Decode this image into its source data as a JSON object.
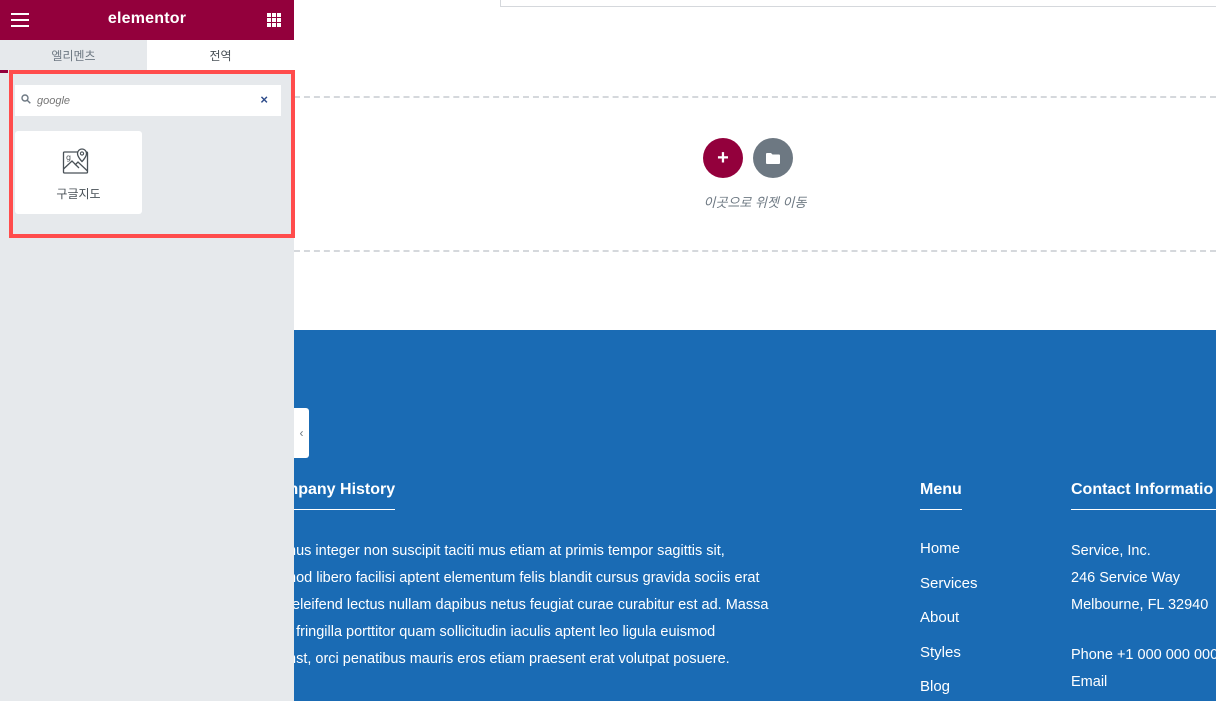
{
  "panel": {
    "logo": "elementor",
    "tabs": [
      {
        "label": "엘리멘츠",
        "active": true
      },
      {
        "label": "전역",
        "active": false
      }
    ],
    "search": {
      "value": "",
      "placeholder": "google"
    },
    "widgets": [
      {
        "label": "구글지도",
        "icon": "map-pin-icon"
      }
    ],
    "accent_color": "#93003c",
    "highlight_color": "#ff4c4c"
  },
  "canvas": {
    "drop_text": "이곳으로 위젯 이동",
    "add_symbol": "+"
  },
  "footer": {
    "background": "#1a6bb4",
    "history": {
      "title": "mpany History",
      "lines": [
        "mus integer non suscipit taciti mus etiam at primis tempor sagittis sit,",
        "mod libero facilisi aptent elementum felis blandit cursus gravida sociis erat",
        ", eleifend lectus nullam dapibus netus feugiat curae curabitur est ad. Massa",
        "e fringilla porttitor quam sollicitudin iaculis aptent leo ligula euismod",
        "mst, orci penatibus mauris eros etiam praesent erat volutpat posuere."
      ]
    },
    "menu": {
      "title": "Menu",
      "items": [
        "Home",
        "Services",
        "About",
        "Styles",
        "Blog"
      ]
    },
    "contact": {
      "title": "Contact Informatio",
      "lines": [
        "Service, Inc.",
        "246 Service Way",
        "Melbourne, FL 32940"
      ],
      "phone": "Phone +1 000 000 000",
      "email": "Email"
    }
  }
}
